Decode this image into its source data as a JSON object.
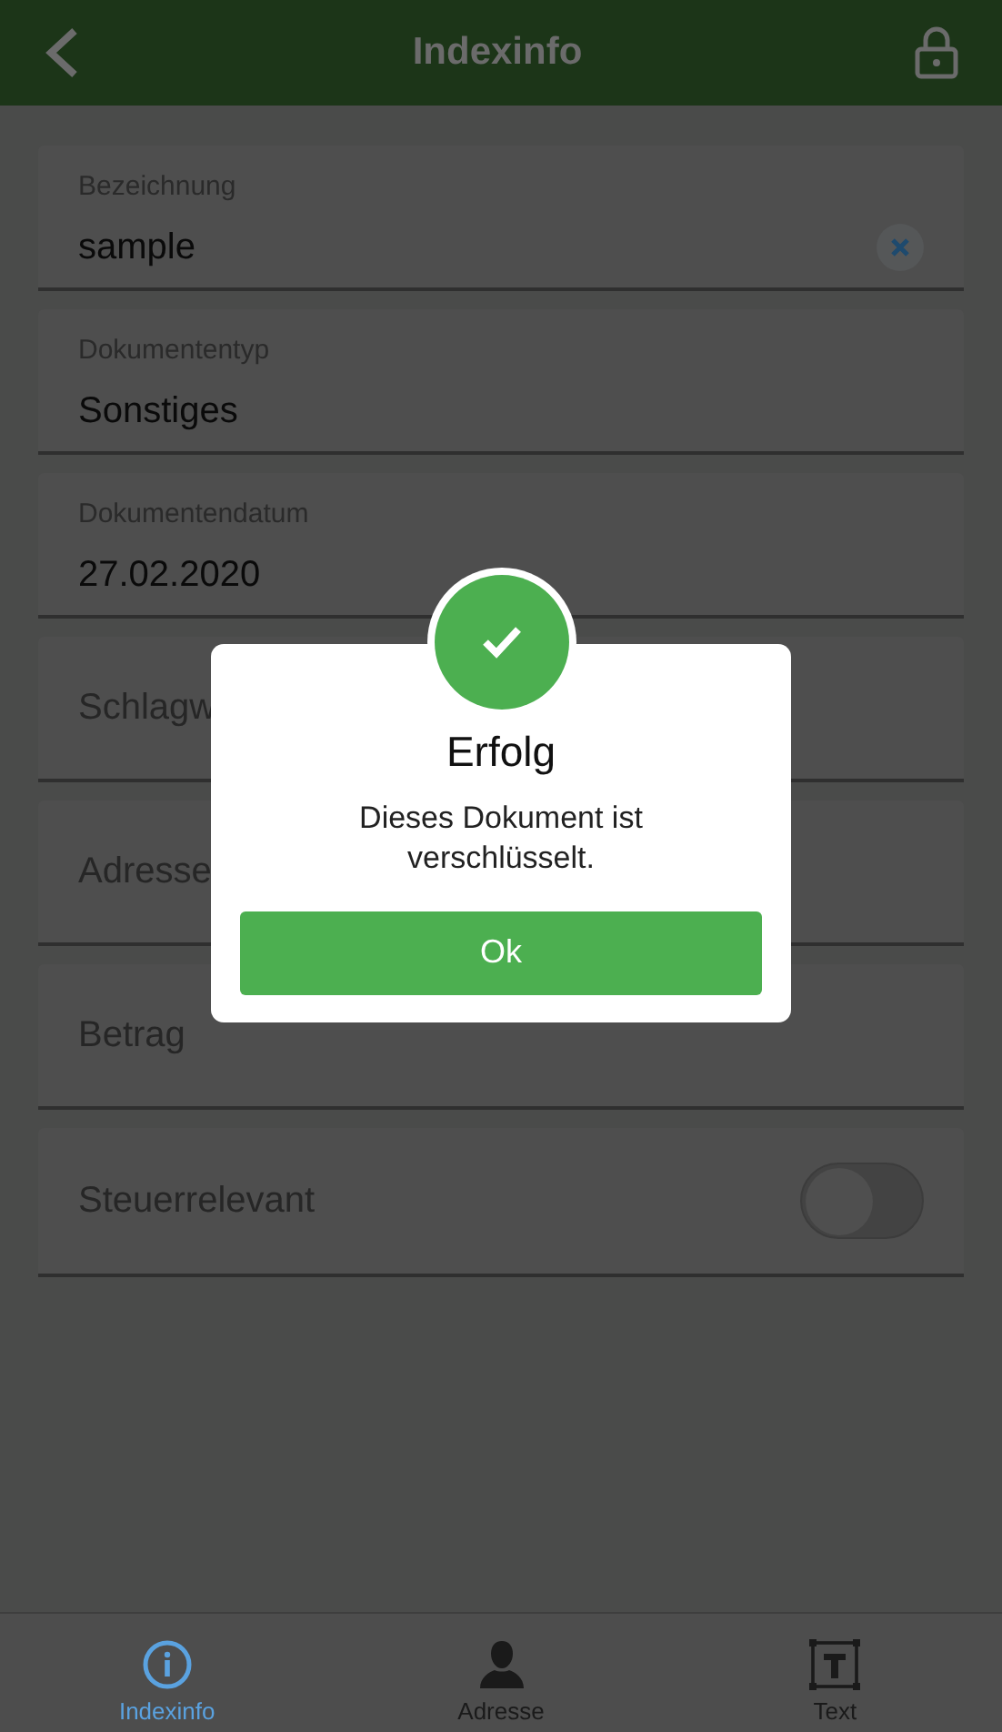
{
  "header": {
    "title": "Indexinfo"
  },
  "fields": [
    {
      "kind": "value",
      "label": "Bezeichnung",
      "value": "sample",
      "clearable": true
    },
    {
      "kind": "value",
      "label": "Dokumententyp",
      "value": "Sonstiges",
      "clearable": false
    },
    {
      "kind": "value",
      "label": "Dokumentendatum",
      "value": "27.02.2020",
      "clearable": false
    },
    {
      "kind": "placeholder",
      "placeholder": "Schlagw"
    },
    {
      "kind": "placeholder",
      "placeholder": "Adresse"
    },
    {
      "kind": "placeholder",
      "placeholder": "Betrag"
    },
    {
      "kind": "toggle",
      "label": "Steuerrelevant",
      "on": false
    }
  ],
  "dialog": {
    "title": "Erfolg",
    "message": "Dieses Dokument ist verschlüsselt.",
    "button": "Ok"
  },
  "tabs": [
    {
      "kind": "info",
      "label": "Indexinfo",
      "selected": true
    },
    {
      "kind": "person",
      "label": "Adresse",
      "selected": false
    },
    {
      "kind": "text",
      "label": "Text",
      "selected": false
    }
  ]
}
